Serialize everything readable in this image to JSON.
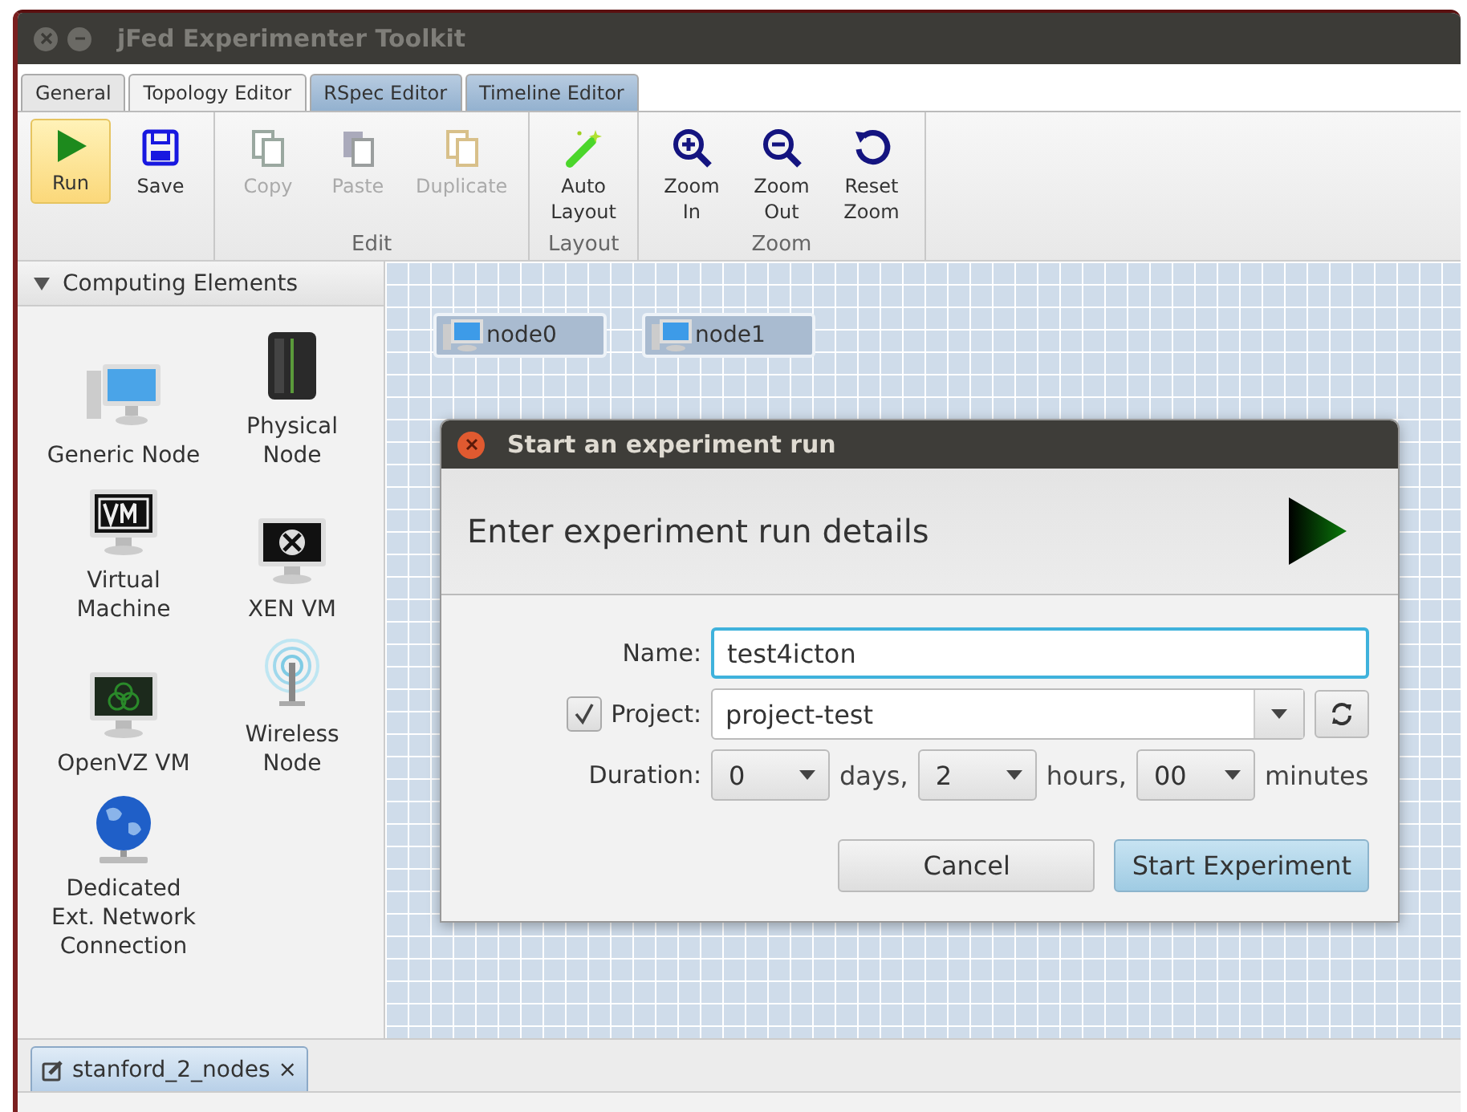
{
  "window": {
    "title": "jFed Experimenter Toolkit"
  },
  "tabs": [
    {
      "label": "General",
      "selected": false
    },
    {
      "label": "Topology Editor",
      "selected": true
    },
    {
      "label": "RSpec Editor",
      "selected": false
    },
    {
      "label": "Timeline Editor",
      "selected": false
    }
  ],
  "ribbon": [
    {
      "items": [
        {
          "label": "Run",
          "selected": true,
          "disabled": false
        },
        {
          "label": "Save",
          "selected": false,
          "disabled": false
        }
      ]
    },
    {
      "label": "Edit",
      "items": [
        {
          "label": "Copy",
          "selected": false,
          "disabled": true
        },
        {
          "label": "Paste",
          "selected": false,
          "disabled": true
        },
        {
          "label": "Duplicate",
          "selected": false,
          "disabled": true
        }
      ]
    },
    {
      "label": "Layout",
      "items": [
        {
          "label": "Auto\nLayout",
          "selected": false,
          "disabled": false
        }
      ]
    },
    {
      "label": "Zoom",
      "items": [
        {
          "label": "Zoom\nIn",
          "selected": false,
          "disabled": false
        },
        {
          "label": "Zoom\nOut",
          "selected": false,
          "disabled": false
        },
        {
          "label": "Reset\nZoom",
          "selected": false,
          "disabled": false
        }
      ]
    }
  ],
  "sidebar": {
    "section": {
      "title": "Computing Elements",
      "expanded": true
    },
    "items": [
      {
        "label": "Generic Node"
      },
      {
        "label": "Physical\nNode"
      },
      {
        "label": "Virtual\nMachine"
      },
      {
        "label": "XEN VM"
      },
      {
        "label": "OpenVZ VM"
      },
      {
        "label": "Wireless\nNode"
      },
      {
        "label": "Dedicated\nExt. Network\nConnection"
      }
    ]
  },
  "canvas": {
    "nodes": [
      {
        "label": "node0"
      },
      {
        "label": "node1"
      }
    ]
  },
  "dialog": {
    "title": "Start an experiment run",
    "heading": "Enter experiment run details",
    "name": {
      "label": "Name:",
      "value": "test4icton"
    },
    "project": {
      "label": "Project:",
      "checked": true,
      "value": "project-test"
    },
    "duration": {
      "label": "Duration:",
      "days": "0",
      "days_unit": "days,",
      "hours": "2",
      "hours_unit": "hours,",
      "minutes": "00",
      "minutes_unit": "minutes"
    },
    "buttons": [
      {
        "label": "Cancel",
        "primary": false
      },
      {
        "label": "Start Experiment",
        "primary": true
      }
    ]
  },
  "document_tabs": [
    {
      "label": "stanford_2_nodes",
      "close": "×"
    }
  ]
}
